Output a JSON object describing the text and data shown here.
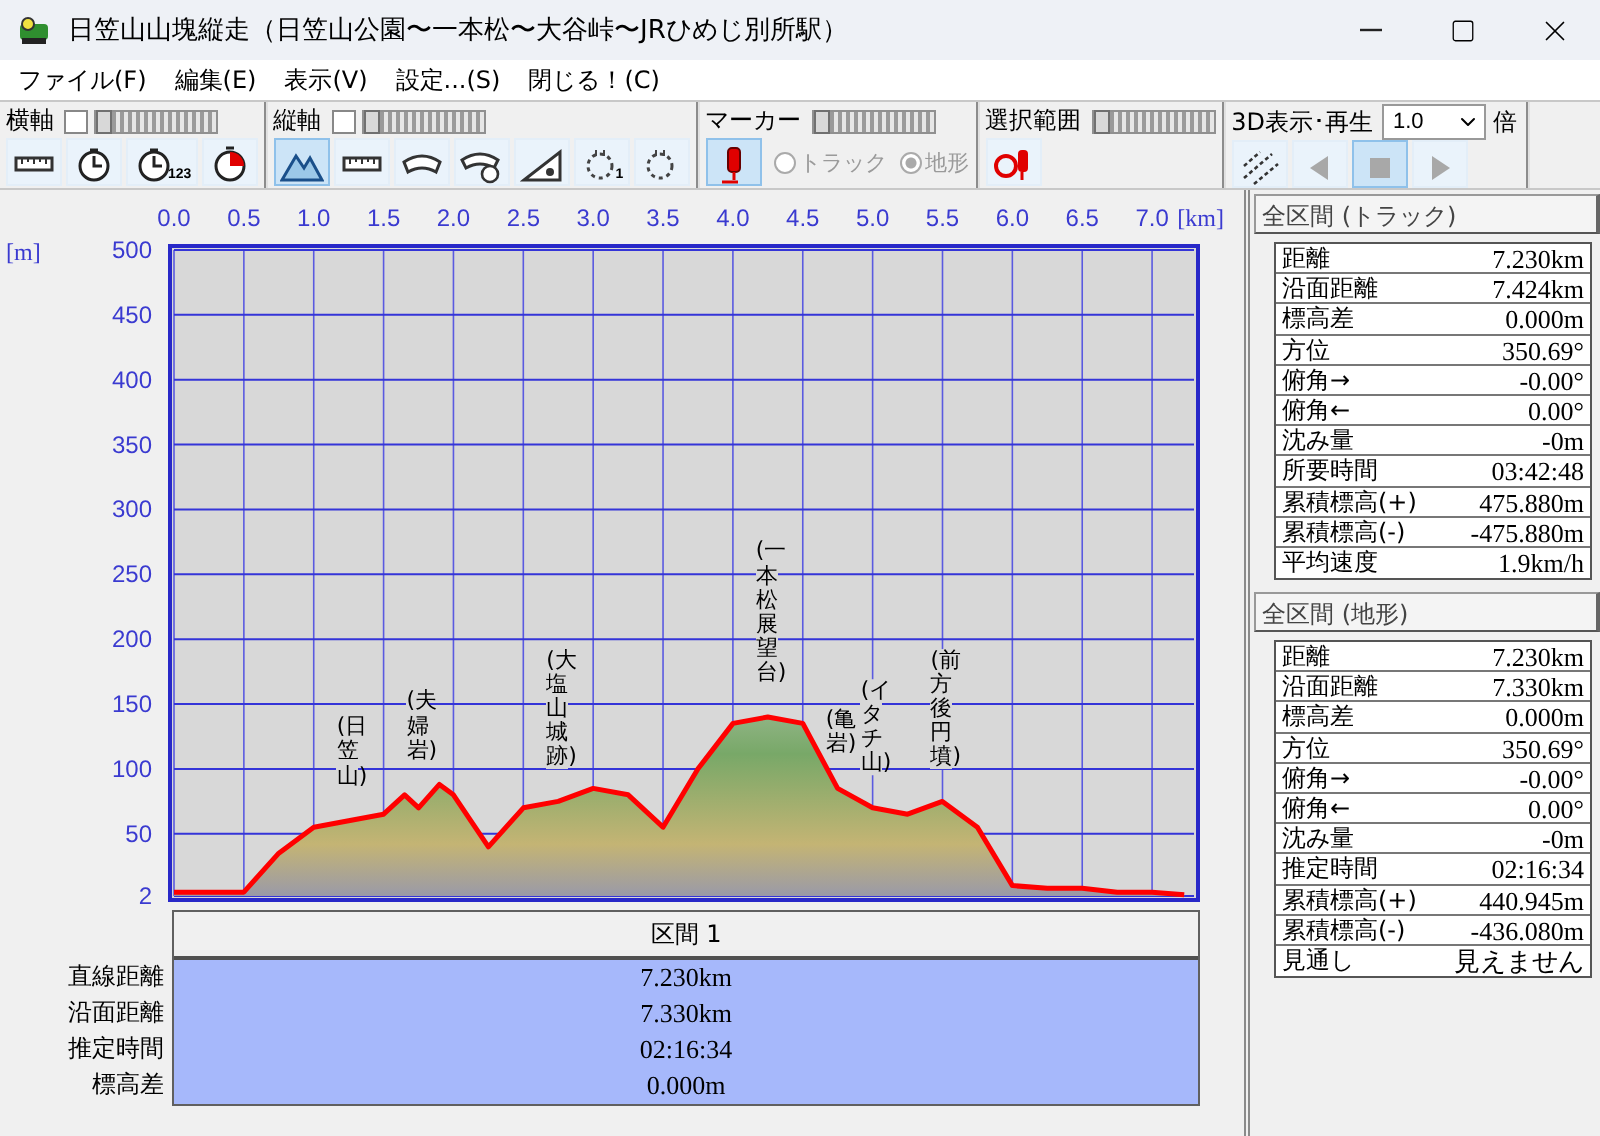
{
  "window": {
    "title": "日笠山山塊縦走（日笠山公園〜一本松〜大谷峠〜JRひめじ別所駅）"
  },
  "menu": [
    "ファイル(F)",
    "編集(E)",
    "表示(V)",
    "設定...(S)",
    "閉じる！(C)"
  ],
  "toolbar": [
    {
      "label": "横軸",
      "checkbox": {
        "checked": false
      },
      "slider": {
        "level": 0
      },
      "tools": [
        {
          "kind": "ruler",
          "selected": false
        },
        {
          "kind": "clock",
          "selected": false
        },
        {
          "kind": "clock",
          "sub": "123",
          "selected": false
        },
        {
          "kind": "pie-clock",
          "selected": false
        }
      ]
    },
    {
      "label": "縦軸",
      "checkbox": {
        "checked": false
      },
      "slider": {
        "level": 0
      },
      "tools": [
        {
          "kind": "mountains",
          "selected": true
        },
        {
          "kind": "ruler",
          "selected": false
        },
        {
          "kind": "curved-ruler",
          "selected": false
        },
        {
          "kind": "curved-clock",
          "selected": false
        },
        {
          "kind": "slope",
          "selected": false
        },
        {
          "kind": "dotted-circle",
          "sub": "1",
          "selected": false
        },
        {
          "kind": "dotted-circle",
          "selected": false
        }
      ]
    },
    {
      "label": "マーカー",
      "slider": {
        "level": 0
      },
      "tools": [
        {
          "kind": "marker",
          "selected": true
        }
      ],
      "radios": [
        {
          "label": "トラック",
          "selected": false,
          "disabled": true
        },
        {
          "label": "地形",
          "selected": true,
          "disabled": true
        }
      ]
    },
    {
      "label": "選択範囲",
      "slider": {
        "level": 0
      },
      "tools": [
        {
          "kind": "range-marker",
          "selected": false
        }
      ]
    },
    {
      "label": "3D表示･再生",
      "select": {
        "value": "1.0",
        "suffix": "倍"
      },
      "tools": [
        {
          "kind": "perspective",
          "selected": false
        },
        {
          "kind": "rewind",
          "selected": false
        },
        {
          "kind": "stop",
          "selected": true
        },
        {
          "kind": "play",
          "selected": false
        }
      ]
    }
  ],
  "profile": {
    "chart_data": {
      "type": "area",
      "grid": true,
      "xlabel": "[km]",
      "ylabel": "[m]",
      "xlim": [
        0,
        7.3
      ],
      "ylim": [
        2,
        500
      ],
      "xticks": [
        {
          "value": 0,
          "label": "0.0"
        },
        {
          "value": 0.5,
          "label": "0.5"
        },
        {
          "value": 1,
          "label": "1.0"
        },
        {
          "value": 1.5,
          "label": "1.5"
        },
        {
          "value": 2,
          "label": "2.0"
        },
        {
          "value": 2.5,
          "label": "2.5"
        },
        {
          "value": 3,
          "label": "3.0"
        },
        {
          "value": 3.5,
          "label": "3.5"
        },
        {
          "value": 4,
          "label": "4.0"
        },
        {
          "value": 4.5,
          "label": "4.5"
        },
        {
          "value": 5,
          "label": "5.0"
        },
        {
          "value": 5.5,
          "label": "5.5"
        },
        {
          "value": 6,
          "label": "6.0"
        },
        {
          "value": 6.5,
          "label": "6.5"
        },
        {
          "value": 7,
          "label": "7.0"
        }
      ],
      "yticks": [
        {
          "value": 2,
          "label": "2"
        },
        50,
        100,
        150,
        200,
        250,
        300,
        350,
        400,
        450,
        500
      ],
      "x": [
        0,
        0.25,
        0.5,
        0.75,
        1,
        1.25,
        1.5,
        1.65,
        1.75,
        1.9,
        2,
        2.25,
        2.5,
        2.75,
        3,
        3.25,
        3.5,
        3.75,
        4,
        4.25,
        4.5,
        4.75,
        5,
        5.25,
        5.5,
        5.75,
        6,
        6.25,
        6.5,
        6.75,
        7,
        7.23
      ],
      "series": [
        {
          "color": "#ff0000",
          "values": [
            5,
            5,
            5,
            35,
            55,
            60,
            65,
            80,
            70,
            88,
            80,
            40,
            70,
            75,
            85,
            80,
            55,
            100,
            135,
            140,
            135,
            85,
            70,
            65,
            75,
            55,
            10,
            8,
            8,
            5,
            5,
            3
          ]
        }
      ],
      "annotations": [
        {
          "x": 1.25,
          "y": 60,
          "text": "(日笠山)"
        },
        {
          "x": 1.75,
          "y": 80,
          "text": "(夫婦岩)"
        },
        {
          "x": 2.75,
          "y": 75,
          "text": "(大塩山城跡)"
        },
        {
          "x": 4.25,
          "y": 140,
          "text": "(一本松展望台)"
        },
        {
          "x": 4.75,
          "y": 85,
          "text": "(亀岩)"
        },
        {
          "x": 5,
          "y": 70,
          "text": "(イタチ山)"
        },
        {
          "x": 5.5,
          "y": 75,
          "text": "(前方後円墳)"
        }
      ]
    }
  },
  "segment": {
    "header": "区間 1",
    "rows": [
      {
        "label": "直線距離",
        "value": "7.230km"
      },
      {
        "label": "沿面距離",
        "value": "7.330km"
      },
      {
        "label": "推定時間",
        "value": "02:16:34"
      },
      {
        "label": "標高差",
        "value": "0.000m"
      }
    ]
  },
  "summary": [
    {
      "title": "全区間 (トラック)",
      "rows": [
        {
          "label": "距離",
          "value": "7.230km"
        },
        {
          "label": "沿面距離",
          "value": "7.424km"
        },
        {
          "label": "標高差",
          "value": "0.000m"
        },
        {
          "label": "方位",
          "value": "350.69°"
        },
        {
          "label": "俯角→",
          "value": "-0.00°"
        },
        {
          "label": "俯角←",
          "value": "0.00°"
        },
        {
          "label": "沈み量",
          "value": "-0m"
        },
        {
          "label": "所要時間",
          "value": "03:42:48"
        },
        {
          "label": "累積標高(+)",
          "value": "475.880m"
        },
        {
          "label": "累積標高(-)",
          "value": "-475.880m"
        },
        {
          "label": "平均速度",
          "value": "1.9km/h"
        }
      ]
    },
    {
      "title": "全区間 (地形)",
      "rows": [
        {
          "label": "距離",
          "value": "7.230km"
        },
        {
          "label": "沿面距離",
          "value": "7.330km"
        },
        {
          "label": "標高差",
          "value": "0.000m"
        },
        {
          "label": "方位",
          "value": "350.69°"
        },
        {
          "label": "俯角→",
          "value": "-0.00°"
        },
        {
          "label": "俯角←",
          "value": "0.00°"
        },
        {
          "label": "沈み量",
          "value": "-0m"
        },
        {
          "label": "推定時間",
          "value": "02:16:34"
        },
        {
          "label": "累積標高(+)",
          "value": "440.945m"
        },
        {
          "label": "累積標高(-)",
          "value": "-436.080m"
        },
        {
          "label": "見通し",
          "value": "見えません"
        }
      ]
    }
  ]
}
